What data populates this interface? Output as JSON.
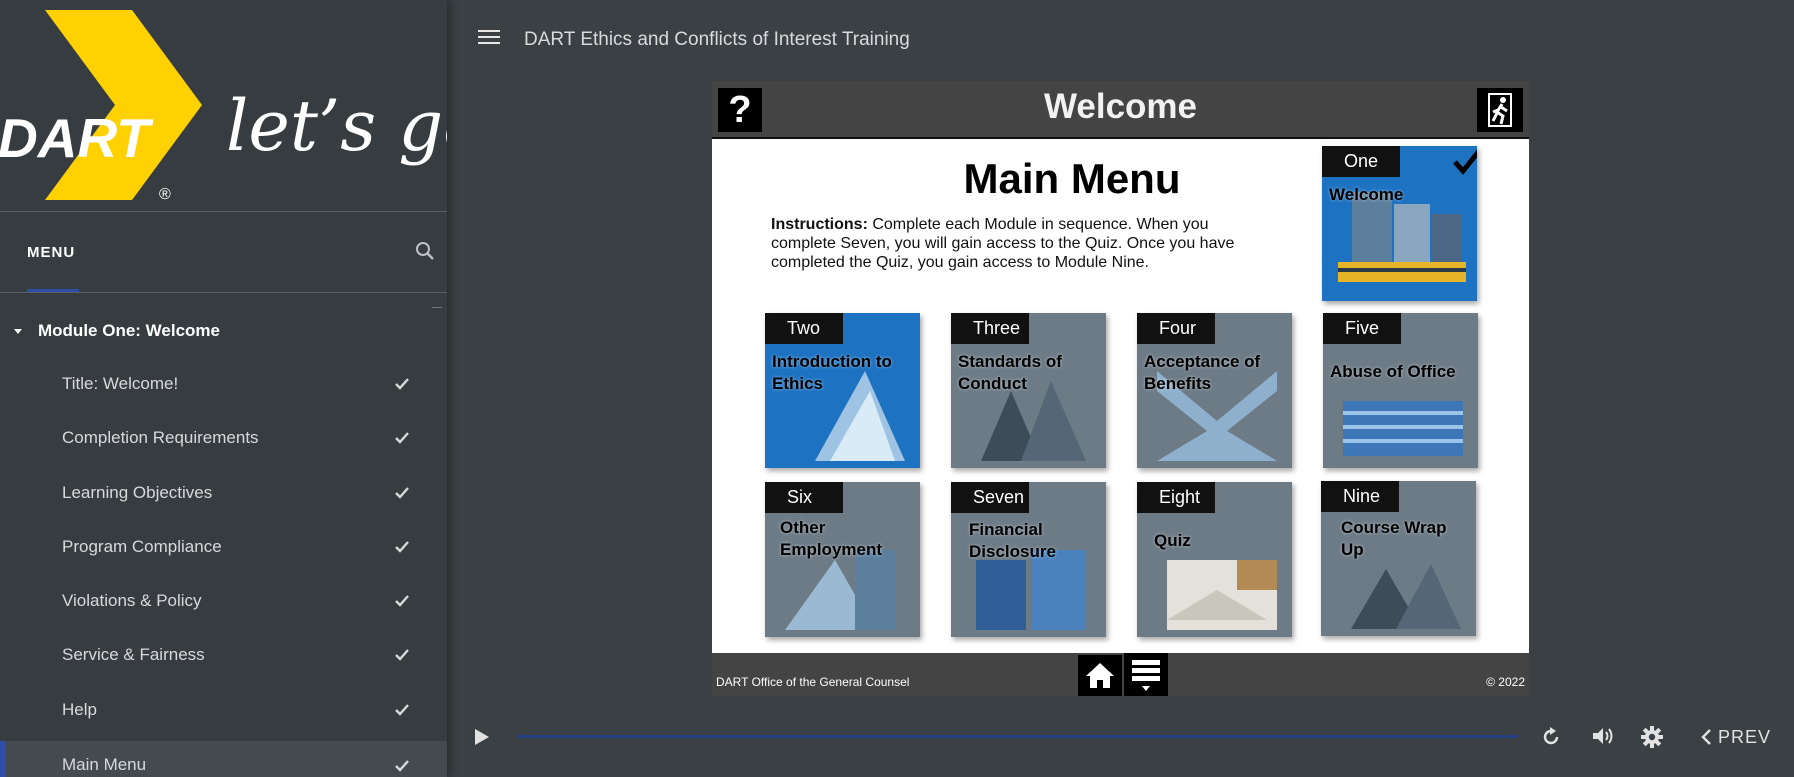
{
  "sidebar": {
    "logo_text": "DART",
    "logo_tagline": "let’s go.",
    "logo_registered": "®",
    "menu_label": "MENU",
    "module_heading": "Module One: Welcome",
    "items": [
      {
        "label": "Title: Welcome!",
        "completed": true
      },
      {
        "label": "Completion Requirements",
        "completed": true
      },
      {
        "label": "Learning Objectives",
        "completed": true
      },
      {
        "label": "Program Compliance",
        "completed": true
      },
      {
        "label": "Violations & Policy",
        "completed": true
      },
      {
        "label": "Service & Fairness",
        "completed": true
      },
      {
        "label": "Help",
        "completed": true
      },
      {
        "label": "Main Menu",
        "completed": true
      }
    ]
  },
  "header": {
    "course_title": "DART Ethics and Conflicts of Interest Training"
  },
  "slide": {
    "title": "Welcome",
    "help_glyph": "?",
    "main_menu_title": "Main Menu",
    "instructions_bold": "Instructions:",
    "instructions_text": " Complete each Module in sequence. When you complete Seven, you will gain access to the Quiz. Once you have completed the Quiz, you gain access to Module Nine.",
    "tiles": [
      {
        "num": "One",
        "name": "Welcome",
        "completed": true
      },
      {
        "num": "Two",
        "name": "Introduction to Ethics"
      },
      {
        "num": "Three",
        "name": "Standards of Conduct"
      },
      {
        "num": "Four",
        "name": "Acceptance of Benefits"
      },
      {
        "num": "Five",
        "name": "Abuse of Office"
      },
      {
        "num": "Six",
        "name": "Other Employment"
      },
      {
        "num": "Seven",
        "name": "Financial Disclosure"
      },
      {
        "num": "Eight",
        "name": "Quiz"
      },
      {
        "num": "Nine",
        "name": "Course Wrap Up"
      }
    ],
    "footer_left": "DART Office of the General Counsel",
    "footer_right": "© 2022"
  },
  "player": {
    "prev_label": "PREV"
  },
  "colors": {
    "dart_yellow": "#ffd100",
    "tile_blue": "#1d72c1",
    "tile_gray": "#6d7b87",
    "accent_blue": "#2e4fa5"
  }
}
